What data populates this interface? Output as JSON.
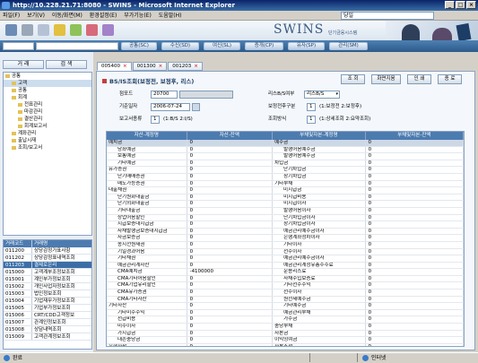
{
  "window": {
    "title": "http://10.228.21.71:8080 - SWINS - Microsoft Internet Explorer"
  },
  "menu": {
    "items": [
      "파일(F)",
      "보기(V)",
      "이동/화면(M)",
      "환경설정(E)",
      "부가기능(E)",
      "도움말(H)"
    ],
    "combo_value": "당일"
  },
  "brand": {
    "name": "SWINS",
    "subtitle": "단기금융시스템"
  },
  "nav": {
    "tabs": [
      "공통(SC)",
      "수신(SD)",
      "여신(SL)",
      "증개(CP)",
      "유자(SP)",
      "관리(SM)"
    ]
  },
  "left": {
    "tabs": [
      "거 래",
      "검 색"
    ],
    "tree": [
      {
        "label": "공통",
        "level": 0,
        "kind": "folder"
      },
      {
        "label": "고객",
        "level": 1,
        "kind": "folder",
        "selected": true
      },
      {
        "label": "공통",
        "level": 1,
        "kind": "folder"
      },
      {
        "label": "회계",
        "level": 1,
        "kind": "folder"
      },
      {
        "label": "전표관리",
        "level": 2,
        "kind": "folder"
      },
      {
        "label": "마감관리",
        "level": 2,
        "kind": "folder"
      },
      {
        "label": "결산관리",
        "level": 2,
        "kind": "folder"
      },
      {
        "label": "회계보고서",
        "level": 2,
        "kind": "folder"
      },
      {
        "label": "계좌관리",
        "level": 1,
        "kind": "folder"
      },
      {
        "label": "출납시재",
        "level": 1,
        "kind": "folder"
      },
      {
        "label": "조회/보고서",
        "level": 1,
        "kind": "folder"
      }
    ],
    "code_header": [
      "거래코드",
      "거래명"
    ],
    "codes": [
      {
        "code": "011200",
        "name": "상당감정가표사항"
      },
      {
        "code": "011202",
        "name": "상당감정표내역조회"
      },
      {
        "code": "011203",
        "name": "결제로은리",
        "selected": true
      },
      {
        "code": "015000",
        "name": "고객계부조정보조회"
      },
      {
        "code": "015001",
        "name": "계인부가정보조회"
      },
      {
        "code": "015002",
        "name": "개인사업자정보조회"
      },
      {
        "code": "015003",
        "name": "법인정보조회"
      },
      {
        "code": "015004",
        "name": "기업재무가정보조회"
      },
      {
        "code": "015005",
        "name": "기업부가정보조회"
      },
      {
        "code": "015006",
        "name": "CRT/CDD고객정보"
      },
      {
        "code": "015007",
        "name": "관계인정보조회"
      },
      {
        "code": "015008",
        "name": "상담내역조회"
      },
      {
        "code": "015009",
        "name": "고객관계정보조회"
      }
    ]
  },
  "tabs": [
    {
      "label": "005400",
      "active": true
    },
    {
      "label": "001300",
      "active": false
    },
    {
      "label": "001203",
      "active": false
    }
  ],
  "form": {
    "title": "BS/IS조회(보정전, 보정후, 리스)",
    "buttons": [
      "조 회",
      "화면지움",
      "인 쇄",
      "종 료"
    ],
    "branch_label": "점포드",
    "branch_code": "20700",
    "branch_name": "",
    "lease_label": "리스B/S여부",
    "lease_value": "리스B/S",
    "date_label": "기준일자",
    "date_value": "2006-07-24",
    "adjust_label": "보정전후구분",
    "adjust_value": "1",
    "adjust_desc": "(1:보정전 2:보정후)",
    "report_label": "보고서종류",
    "report_value": "1",
    "report_desc": "(1:B/S 2:I/S)",
    "query_label": "조회방식",
    "query_value": "1",
    "query_desc": "(1:상세조회 2:요약조회)"
  },
  "grid": {
    "headers": [
      "자산-계정명",
      "자산-잔액",
      "부채및자본-계정명",
      "부채및자본-잔액"
    ],
    "rows": [
      [
        "예치금",
        "0",
        "예수금",
        "0"
      ],
      [
        "당좌예금",
        "0",
        "발행어음예수금",
        "0"
      ],
      [
        "보통예금",
        "0",
        "발행어음예수금",
        "0"
      ],
      [
        "기타예금",
        "0",
        "차입금",
        "0"
      ],
      [
        "유가증권",
        "0",
        "단기차입금",
        "0"
      ],
      [
        "단기매매증권",
        "0",
        "장기차입금",
        "0"
      ],
      [
        "매도가능증권",
        "0",
        "기타부채",
        "0"
      ],
      [
        "대출채권",
        "0",
        "미지급금",
        "0"
      ],
      [
        "단기원화대출금",
        "0",
        "미지급비용",
        "0"
      ],
      [
        "단기외화대출금",
        "0",
        "미지급이자",
        "0"
      ],
      [
        "기타대출금",
        "0",
        "발행어음이자",
        "0"
      ],
      [
        "상업어음할인",
        "0",
        "단기차입금이자",
        "0"
      ],
      [
        "지급보증대지급금",
        "0",
        "장기차입금이자",
        "0"
      ],
      [
        "사채발행금보증대지급금",
        "0",
        "예금관리예수금이자",
        "0"
      ],
      [
        "자금보증금",
        "0",
        "은행계좌정차이자",
        "0"
      ],
      [
        "송지전원재권",
        "0",
        "기타이자",
        "0"
      ],
      [
        "기일경과어음",
        "0",
        "선수이자",
        "0"
      ],
      [
        "기타채권",
        "0",
        "예금관리예수금이자",
        "0"
      ],
      [
        "예금관리계자산",
        "0",
        "예금관리계정유총수수료",
        "0"
      ],
      [
        "CMA예치금",
        "-4100000",
        "운용리스료",
        "0"
      ],
      [
        "CMA기타어음할인",
        "0",
        "사채수입보증료",
        "0"
      ],
      [
        "CMA기업유리할인",
        "0",
        "기타선수수익",
        "0"
      ],
      [
        "CMA유가증권",
        "0",
        "선수이자",
        "0"
      ],
      [
        "CMA기타자산",
        "0",
        "원천세예수금",
        "0"
      ],
      [
        "기타자산",
        "0",
        "기타예수금",
        "0"
      ],
      [
        "기타미수수익",
        "0",
        "예금관리부채",
        "0"
      ],
      [
        "선급비용",
        "0",
        "가수금",
        "0"
      ],
      [
        "미수이자",
        "0",
        "충당부채",
        "0"
      ],
      [
        "가지급금",
        "0",
        "자본금",
        "0"
      ],
      [
        "대손충당금",
        "0",
        "이익잉여금",
        "0"
      ],
      [
        "유형자산",
        "0",
        "자본조정",
        "0"
      ]
    ]
  },
  "status": {
    "left": "완료",
    "zone": "인터넷"
  }
}
